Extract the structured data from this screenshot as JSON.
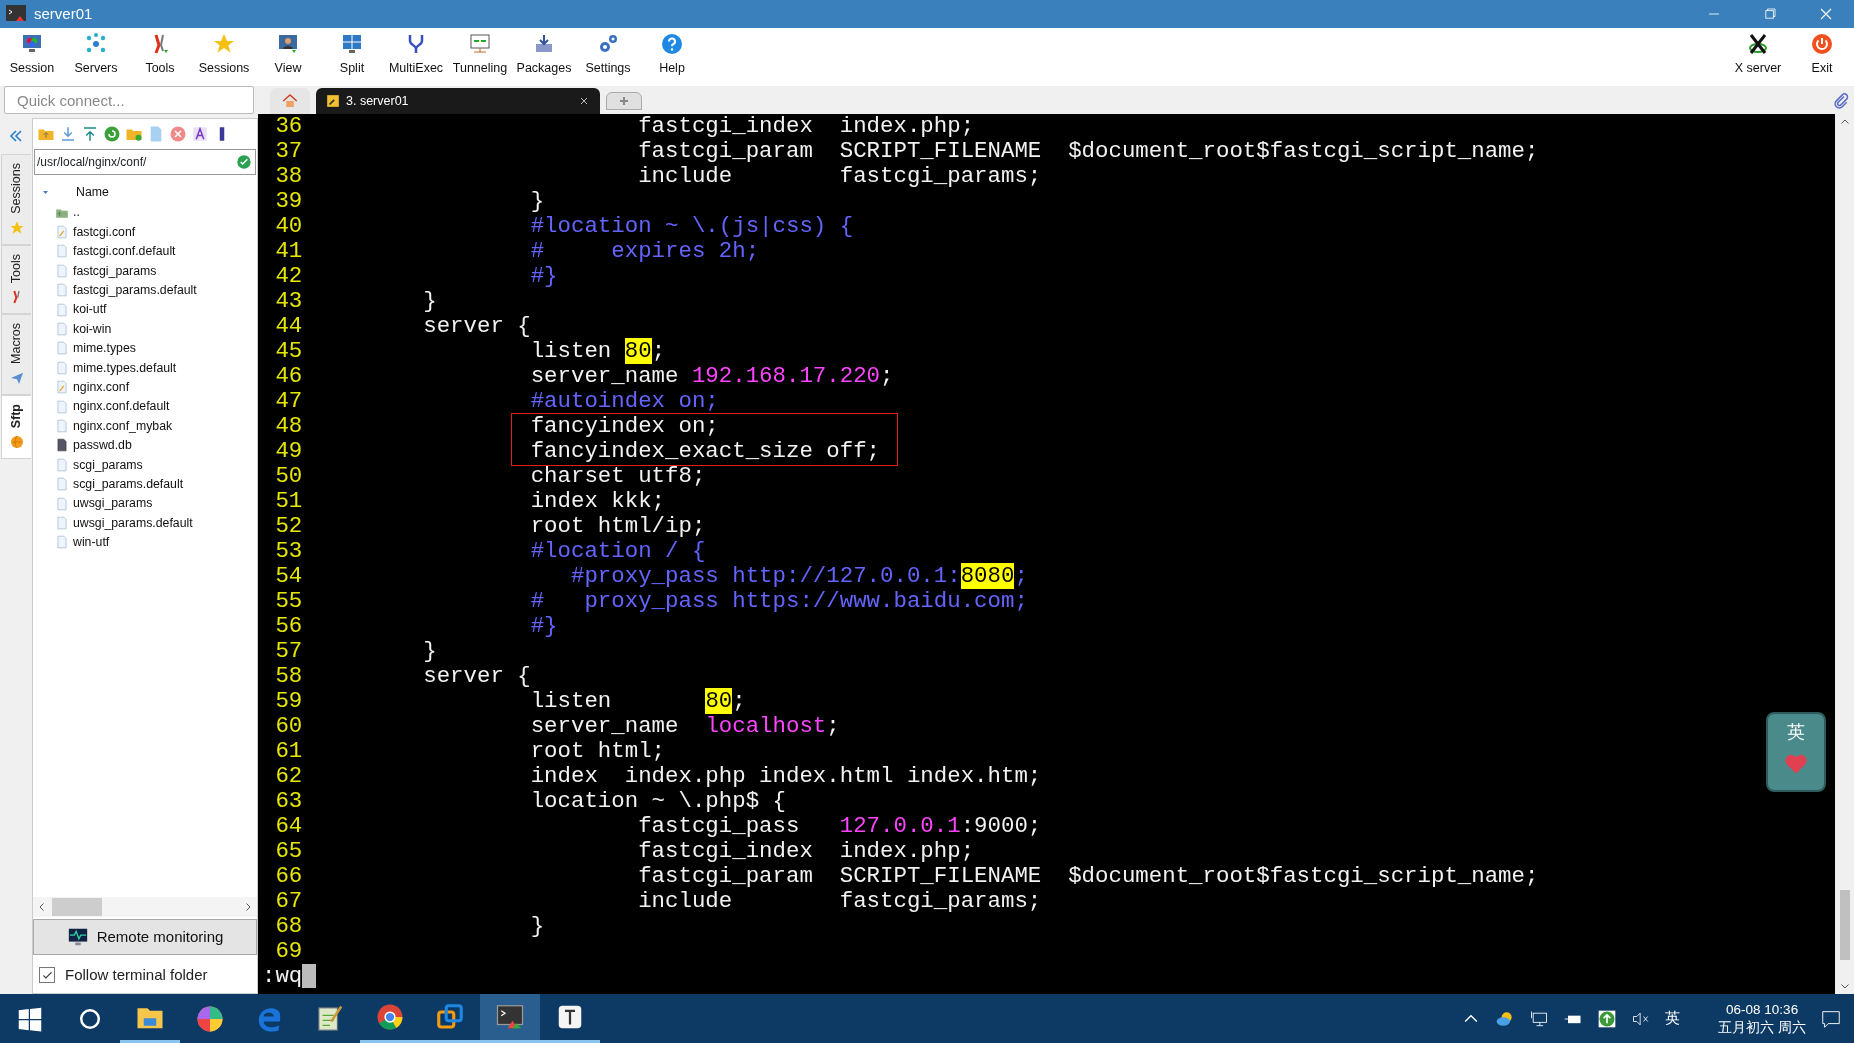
{
  "window": {
    "title": "server01"
  },
  "toolbar": {
    "left": [
      {
        "label": "Session"
      },
      {
        "label": "Servers"
      },
      {
        "label": "Tools"
      },
      {
        "label": "Sessions"
      },
      {
        "label": "View"
      },
      {
        "label": "Split"
      },
      {
        "label": "MultiExec"
      },
      {
        "label": "Tunneling"
      },
      {
        "label": "Packages"
      },
      {
        "label": "Settings"
      },
      {
        "label": "Help"
      }
    ],
    "right": [
      {
        "label": "X server"
      },
      {
        "label": "Exit"
      }
    ]
  },
  "quick_connect": {
    "placeholder": "Quick connect..."
  },
  "side_tabs": [
    {
      "label": "Sessions",
      "selected": false
    },
    {
      "label": "Tools",
      "selected": false
    },
    {
      "label": "Macros",
      "selected": false
    },
    {
      "label": "Sftp",
      "selected": true
    }
  ],
  "sftp": {
    "path": "/usr/local/nginx/conf/",
    "column": "Name",
    "files": [
      {
        "name": "..",
        "kind": "parent"
      },
      {
        "name": "fastcgi.conf",
        "kind": "edited"
      },
      {
        "name": "fastcgi.conf.default",
        "kind": "file"
      },
      {
        "name": "fastcgi_params",
        "kind": "file"
      },
      {
        "name": "fastcgi_params.default",
        "kind": "file"
      },
      {
        "name": "koi-utf",
        "kind": "file"
      },
      {
        "name": "koi-win",
        "kind": "file"
      },
      {
        "name": "mime.types",
        "kind": "file"
      },
      {
        "name": "mime.types.default",
        "kind": "file"
      },
      {
        "name": "nginx.conf",
        "kind": "edited"
      },
      {
        "name": "nginx.conf.default",
        "kind": "file"
      },
      {
        "name": "nginx.conf_mybak",
        "kind": "file"
      },
      {
        "name": "passwd.db",
        "kind": "database"
      },
      {
        "name": "scgi_params",
        "kind": "file"
      },
      {
        "name": "scgi_params.default",
        "kind": "file"
      },
      {
        "name": "uwsgi_params",
        "kind": "file"
      },
      {
        "name": "uwsgi_params.default",
        "kind": "file"
      },
      {
        "name": "win-utf",
        "kind": "file"
      }
    ],
    "monitor_button": "Remote monitoring",
    "follow": {
      "label": "Follow terminal folder",
      "checked": true
    }
  },
  "tabs": [
    {
      "kind": "home"
    },
    {
      "kind": "session",
      "label": "3. server01",
      "selected": true
    },
    {
      "kind": "new"
    }
  ],
  "terminal": {
    "lines": [
      {
        "number": "36",
        "boxed": false,
        "segments": [
          {
            "kind": "text",
            "text": "                        fastcgi_index  index.php;"
          }
        ]
      },
      {
        "number": "37",
        "boxed": false,
        "segments": [
          {
            "kind": "text",
            "text": "                        fastcgi_param  SCRIPT_FILENAME  $document_root$fastcgi_script_name;"
          }
        ]
      },
      {
        "number": "38",
        "boxed": false,
        "segments": [
          {
            "kind": "text",
            "text": "                        include        fastcgi_params;"
          }
        ]
      },
      {
        "number": "39",
        "boxed": false,
        "segments": [
          {
            "kind": "text",
            "text": "                }"
          }
        ]
      },
      {
        "number": "40",
        "boxed": false,
        "segments": [
          {
            "kind": "comment",
            "text": "                #location ~ \\.(js|css) {"
          }
        ]
      },
      {
        "number": "41",
        "boxed": false,
        "segments": [
          {
            "kind": "comment",
            "text": "                #     expires 2h;"
          }
        ]
      },
      {
        "number": "42",
        "boxed": false,
        "segments": [
          {
            "kind": "comment",
            "text": "                #}"
          }
        ]
      },
      {
        "number": "43",
        "boxed": false,
        "segments": [
          {
            "kind": "text",
            "text": "        }"
          }
        ]
      },
      {
        "number": "44",
        "boxed": false,
        "segments": [
          {
            "kind": "text",
            "text": "        server {"
          }
        ]
      },
      {
        "number": "45",
        "boxed": false,
        "segments": [
          {
            "kind": "text",
            "text": "                listen "
          },
          {
            "kind": "match",
            "text": "80"
          },
          {
            "kind": "text",
            "text": ";"
          }
        ]
      },
      {
        "number": "46",
        "boxed": false,
        "segments": [
          {
            "kind": "text",
            "text": "                server_name "
          },
          {
            "kind": "string",
            "text": "192.168.17.220"
          },
          {
            "kind": "text",
            "text": ";"
          }
        ]
      },
      {
        "number": "47",
        "boxed": false,
        "segments": [
          {
            "kind": "comment",
            "text": "                #autoindex on;"
          }
        ]
      },
      {
        "number": "48",
        "boxed": true,
        "segments": [
          {
            "kind": "text",
            "text": "                fancyindex on;"
          }
        ]
      },
      {
        "number": "49",
        "boxed": true,
        "segments": [
          {
            "kind": "text",
            "text": "                fancyindex_exact_size off;"
          }
        ]
      },
      {
        "number": "50",
        "boxed": false,
        "segments": [
          {
            "kind": "text",
            "text": "                charset utf8;"
          }
        ]
      },
      {
        "number": "51",
        "boxed": false,
        "segments": [
          {
            "kind": "text",
            "text": "                index kkk;"
          }
        ]
      },
      {
        "number": "52",
        "boxed": false,
        "segments": [
          {
            "kind": "text",
            "text": "                root html/ip;"
          }
        ]
      },
      {
        "number": "53",
        "boxed": false,
        "segments": [
          {
            "kind": "comment",
            "text": "                #location / {"
          }
        ]
      },
      {
        "number": "54",
        "boxed": false,
        "segments": [
          {
            "kind": "comment",
            "text": "                   #proxy_pass http://127.0.0.1:"
          },
          {
            "kind": "match",
            "text": "8080"
          },
          {
            "kind": "comment",
            "text": ";"
          }
        ]
      },
      {
        "number": "55",
        "boxed": false,
        "segments": [
          {
            "kind": "comment",
            "text": "                #   proxy_pass https://www.baidu.com;"
          }
        ]
      },
      {
        "number": "56",
        "boxed": false,
        "segments": [
          {
            "kind": "comment",
            "text": "                #}"
          }
        ]
      },
      {
        "number": "57",
        "boxed": false,
        "segments": [
          {
            "kind": "text",
            "text": "        }"
          }
        ]
      },
      {
        "number": "58",
        "boxed": false,
        "segments": [
          {
            "kind": "text",
            "text": "        server {"
          }
        ]
      },
      {
        "number": "59",
        "boxed": false,
        "segments": [
          {
            "kind": "text",
            "text": "                listen       "
          },
          {
            "kind": "match",
            "text": "80"
          },
          {
            "kind": "text",
            "text": ";"
          }
        ]
      },
      {
        "number": "60",
        "boxed": false,
        "segments": [
          {
            "kind": "text",
            "text": "                server_name  "
          },
          {
            "kind": "string",
            "text": "localhost"
          },
          {
            "kind": "text",
            "text": ";"
          }
        ]
      },
      {
        "number": "61",
        "boxed": false,
        "segments": [
          {
            "kind": "text",
            "text": "                root html;"
          }
        ]
      },
      {
        "number": "62",
        "boxed": false,
        "segments": [
          {
            "kind": "text",
            "text": "                index  index.php index.html index.htm;"
          }
        ]
      },
      {
        "number": "63",
        "boxed": false,
        "segments": [
          {
            "kind": "text",
            "text": "                location ~ \\.php$ {"
          }
        ]
      },
      {
        "number": "64",
        "boxed": false,
        "segments": [
          {
            "kind": "text",
            "text": "                        fastcgi_pass   "
          },
          {
            "kind": "string",
            "text": "127.0.0.1"
          },
          {
            "kind": "text",
            "text": ":9000;"
          }
        ]
      },
      {
        "number": "65",
        "boxed": false,
        "segments": [
          {
            "kind": "text",
            "text": "                        fastcgi_index  index.php;"
          }
        ]
      },
      {
        "number": "66",
        "boxed": false,
        "segments": [
          {
            "kind": "text",
            "text": "                        fastcgi_param  SCRIPT_FILENAME  $document_root$fastcgi_script_name;"
          }
        ]
      },
      {
        "number": "67",
        "boxed": false,
        "segments": [
          {
            "kind": "text",
            "text": "                        include        fastcgi_params;"
          }
        ]
      },
      {
        "number": "68",
        "boxed": false,
        "segments": [
          {
            "kind": "text",
            "text": "                }"
          }
        ]
      },
      {
        "number": "69",
        "boxed": false
      }
    ],
    "command": ":wq"
  },
  "ime_widget": {
    "label": "英"
  },
  "taskbar": {
    "apps": [
      {
        "running": true,
        "selected": false
      },
      {
        "running": false,
        "selected": false
      },
      {
        "running": false,
        "selected": false
      },
      {
        "running": false,
        "selected": false
      },
      {
        "running": true,
        "selected": false
      },
      {
        "running": true,
        "selected": false
      },
      {
        "running": true,
        "selected": true
      },
      {
        "running": true,
        "selected": false
      }
    ],
    "ime": "英",
    "time": "06-08 10:36",
    "date": "五月初六 周六"
  }
}
